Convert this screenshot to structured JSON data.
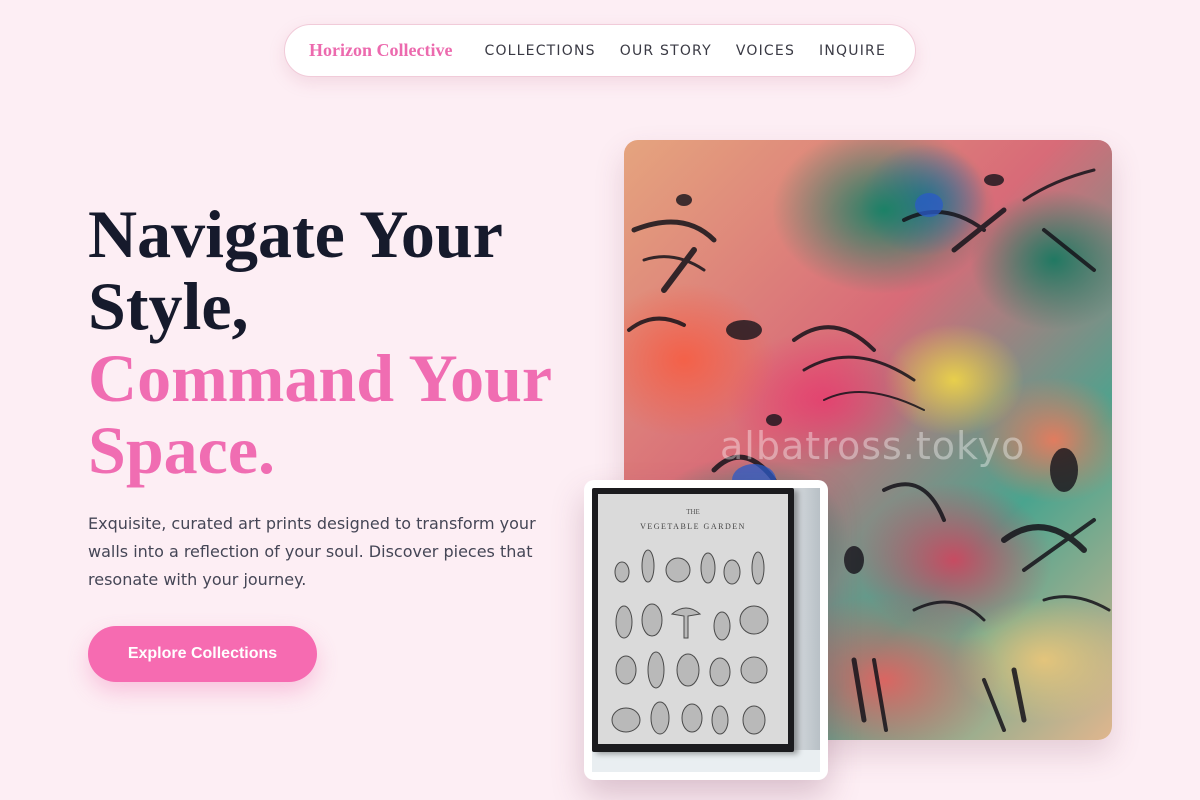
{
  "nav": {
    "brand": "Horizon Collective",
    "links": [
      {
        "label": "COLLECTIONS"
      },
      {
        "label": "OUR STORY"
      },
      {
        "label": "VOICES"
      },
      {
        "label": "INQUIRE"
      }
    ]
  },
  "hero": {
    "headline_line1": "Navigate Your Style,",
    "headline_line2": "Command Your Space.",
    "description": "Exquisite, curated art prints designed to transform your walls into a reflection of your soul. Discover pieces that resonate with your journey.",
    "cta_label": "Explore Collections"
  },
  "artwork": {
    "watermark": "albatross.tokyo",
    "print_title_small": "THE",
    "print_title": "VEGETABLE GARDEN"
  },
  "colors": {
    "background": "#fdeef4",
    "accent": "#f06db2",
    "heading": "#161a2c",
    "body_text": "#454656",
    "button": "#f66bb1"
  }
}
